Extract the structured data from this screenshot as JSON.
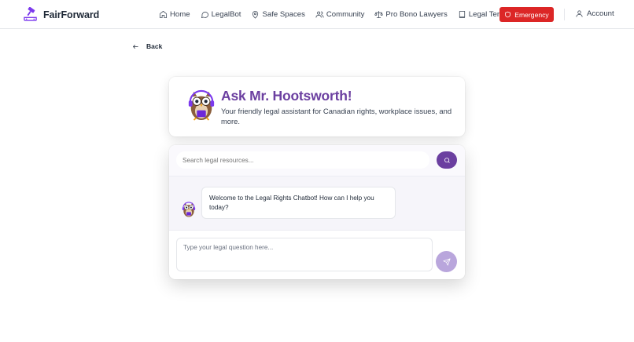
{
  "brand": {
    "name": "FairForward",
    "icon": "gavel-logo-icon"
  },
  "nav": [
    {
      "label": "Home",
      "icon": "home-icon"
    },
    {
      "label": "LegalBot",
      "icon": "chat-bubble-icon"
    },
    {
      "label": "Safe Spaces",
      "icon": "map-pin-icon"
    },
    {
      "label": "Community",
      "icon": "users-icon"
    },
    {
      "label": "Pro Bono Lawyers",
      "icon": "scale-icon"
    },
    {
      "label": "Legal Terms",
      "icon": "book-icon"
    }
  ],
  "emergency": {
    "label": "Emergency",
    "icon": "shield-icon",
    "color": "#dc2626"
  },
  "account": {
    "label": "Account",
    "icon": "user-icon"
  },
  "back": {
    "label": "Back",
    "icon": "arrow-left-icon"
  },
  "hero": {
    "title": "Ask Mr. Hootsworth!",
    "subtitle": "Your friendly legal assistant for Canadian rights, workplace issues, and more.",
    "accent": "#6b3fa0"
  },
  "chat": {
    "search_placeholder": "Search legal resources...",
    "messages": [
      {
        "sender": "bot",
        "text": "Welcome to the Legal Rights Chatbot! How can I help you today?"
      }
    ],
    "input_placeholder": "Type your legal question here...",
    "send_icon": "send-icon",
    "search_icon": "search-icon"
  }
}
